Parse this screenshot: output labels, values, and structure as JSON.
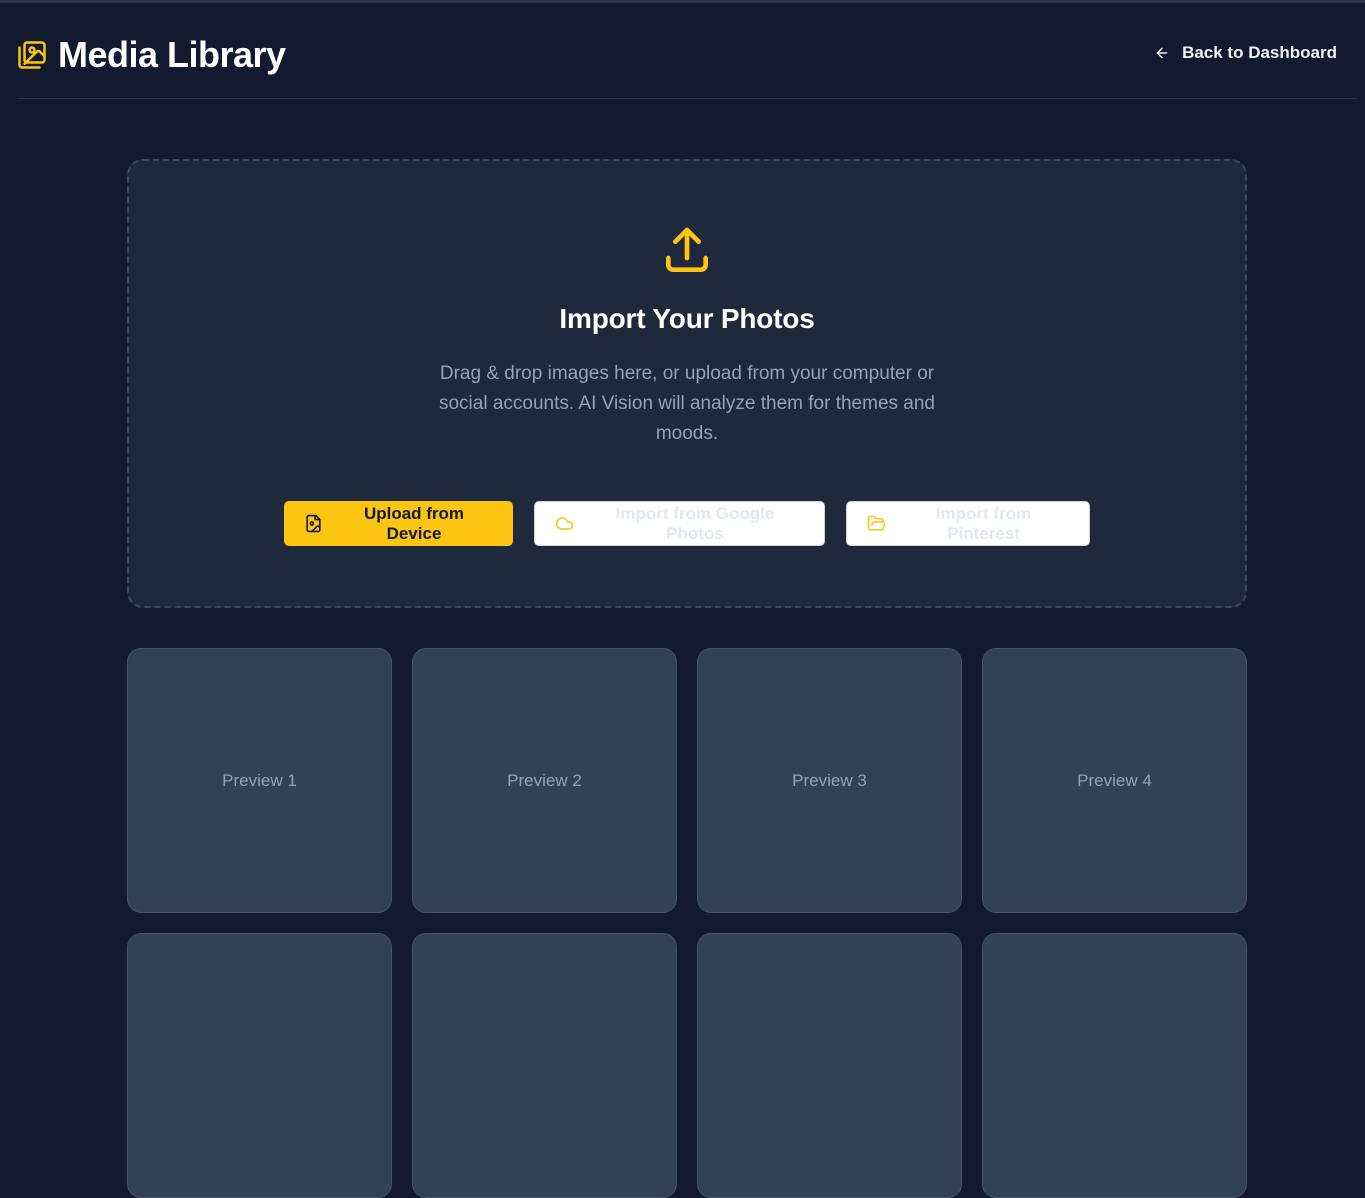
{
  "header": {
    "title": "Media Library",
    "title_icon": "images-icon",
    "back_link": {
      "label": "Back to Dashboard",
      "icon": "arrow-left-icon"
    }
  },
  "dropzone": {
    "icon": "upload-icon",
    "title": "Import Your Photos",
    "description": "Drag & drop images here, or upload from your computer or social accounts. AI Vision will analyze them for themes and moods.",
    "buttons": {
      "device": {
        "label": "Upload from Device",
        "icon": "file-image-icon"
      },
      "google": {
        "label": "Import from Google Photos",
        "icon": "cloud-icon"
      },
      "pinterest": {
        "label": "Import from Pinterest",
        "icon": "folder-open-icon"
      }
    }
  },
  "previews": [
    {
      "label": "Preview 1"
    },
    {
      "label": "Preview 2"
    },
    {
      "label": "Preview 3"
    },
    {
      "label": "Preview 4"
    },
    {
      "label": ""
    },
    {
      "label": ""
    },
    {
      "label": ""
    },
    {
      "label": ""
    }
  ],
  "colors": {
    "accent": "#fbc512",
    "background": "#111a2e",
    "panel": "#1e293b",
    "tile": "#334155",
    "muted_text": "#94a3b8"
  }
}
